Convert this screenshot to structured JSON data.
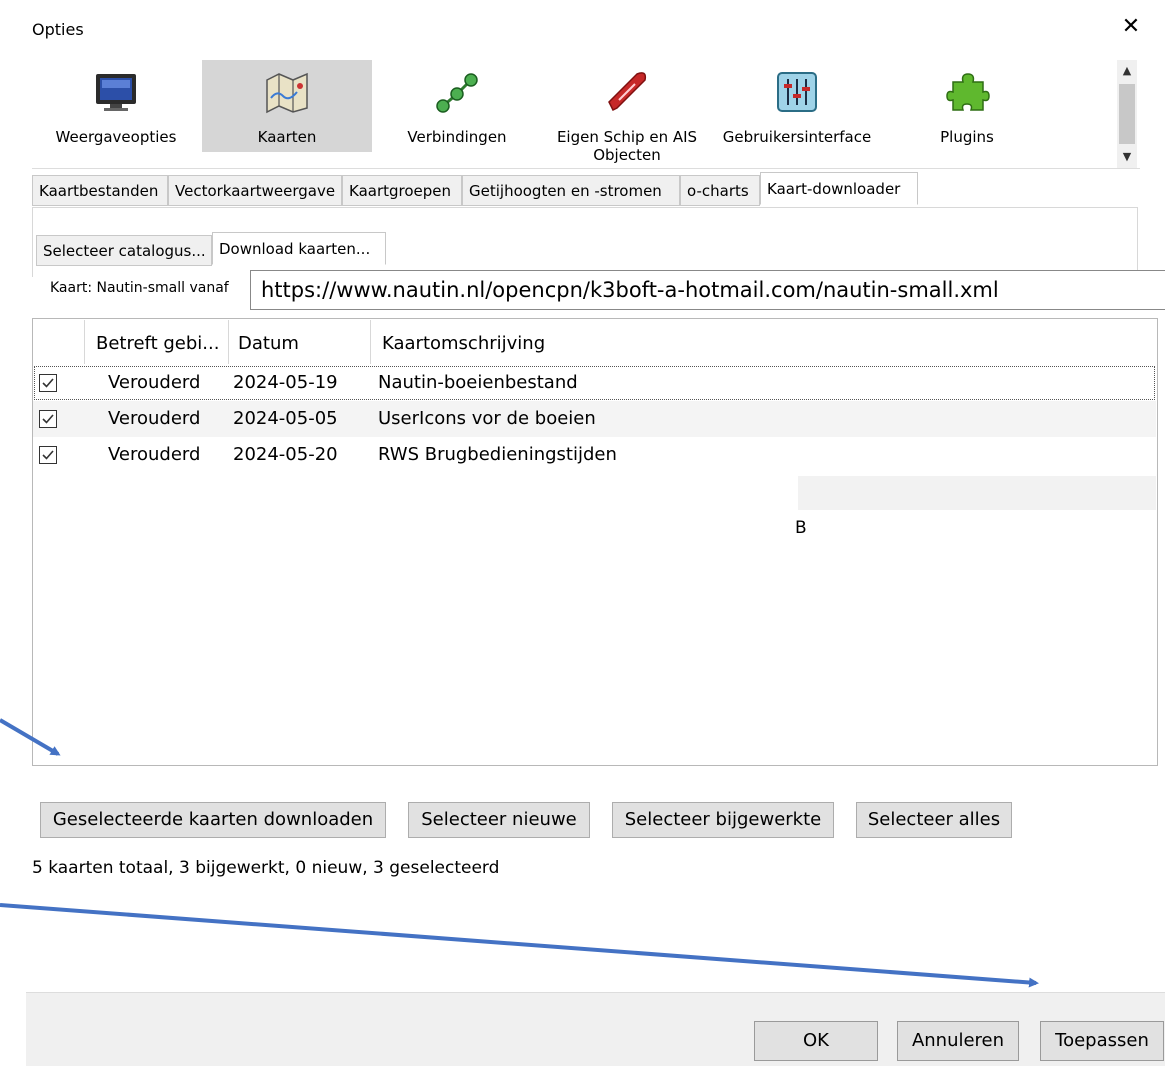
{
  "window": {
    "title": "Opties",
    "close_glyph": "✕"
  },
  "toolbar": {
    "items": [
      {
        "label": "Weergaveopties",
        "icon": "monitor-icon"
      },
      {
        "label": "Kaarten",
        "icon": "map-icon",
        "selected": true
      },
      {
        "label": "Verbindingen",
        "icon": "connections-icon"
      },
      {
        "label": "Eigen Schip en AIS Objecten",
        "icon": "ship-icon"
      },
      {
        "label": "Gebruikersinterface",
        "icon": "sliders-icon"
      },
      {
        "label": "Plugins",
        "icon": "puzzle-icon"
      }
    ]
  },
  "tabs_main": [
    {
      "label": "Kaartbestanden"
    },
    {
      "label": "Vectorkaartweergave"
    },
    {
      "label": "Kaartgroepen"
    },
    {
      "label": "Getijhoogten en -stromen"
    },
    {
      "label": "o-charts"
    },
    {
      "label": "Kaart-downloader",
      "selected": true
    }
  ],
  "tabs_sub": [
    {
      "label": "Selecteer catalogus..."
    },
    {
      "label": "Download kaarten...",
      "selected": true
    }
  ],
  "source": {
    "label": "Kaart: Nautin-small vanaf",
    "url": "https://www.nautin.nl/opencpn/k3boft-a-hotmail.com/nautin-small.xml"
  },
  "list": {
    "columns": [
      "Betreft gebi...",
      "Datum",
      "Kaartomschrijving"
    ],
    "rows": [
      {
        "checked": true,
        "status": "Verouderd",
        "date": "2024-05-19",
        "description": "Nautin-boeienbestand"
      },
      {
        "checked": true,
        "status": "Verouderd",
        "date": "2024-05-05",
        "description": "UserIcons vor de boeien"
      },
      {
        "checked": true,
        "status": "Verouderd",
        "date": "2024-05-20",
        "description": "RWS Brugbedieningstijden"
      }
    ],
    "stray_text": "B"
  },
  "actions": {
    "download": "Geselecteerde kaarten downloaden",
    "select_new": "Selecteer nieuwe",
    "select_updated": "Selecteer bijgewerkte",
    "select_all": "Selecteer alles"
  },
  "status": "5 kaarten totaal, 3 bijgewerkt, 0 nieuw, 3 geselecteerd",
  "dialog_buttons": {
    "ok": "OK",
    "cancel": "Annuleren",
    "apply": "Toepassen"
  },
  "annotation_color": "#4472C4"
}
